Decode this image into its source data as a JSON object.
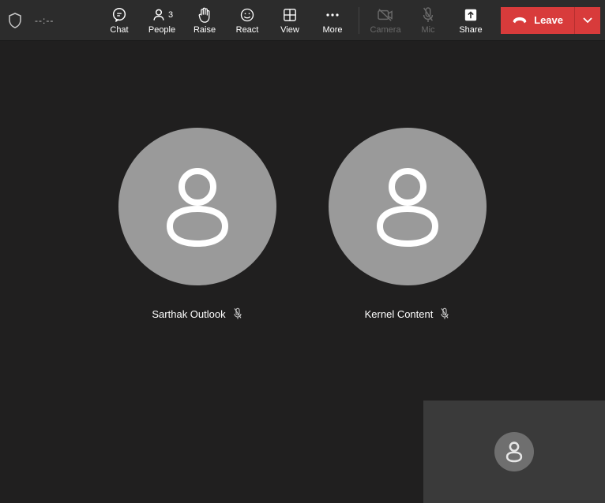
{
  "toolbar": {
    "timer": "--:--",
    "chat_label": "Chat",
    "people_label": "People",
    "people_count": "3",
    "raise_label": "Raise",
    "react_label": "React",
    "view_label": "View",
    "more_label": "More",
    "camera_label": "Camera",
    "mic_label": "Mic",
    "share_label": "Share",
    "leave_label": "Leave"
  },
  "participants": [
    {
      "name": "Sarthak Outlook",
      "muted": true
    },
    {
      "name": "Kernel Content",
      "muted": true
    }
  ],
  "colors": {
    "toolbar_bg": "#2c2c2c",
    "stage_bg": "#201f1f",
    "avatar_bg": "#9a9a9a",
    "leave_red": "#d83b3b"
  }
}
